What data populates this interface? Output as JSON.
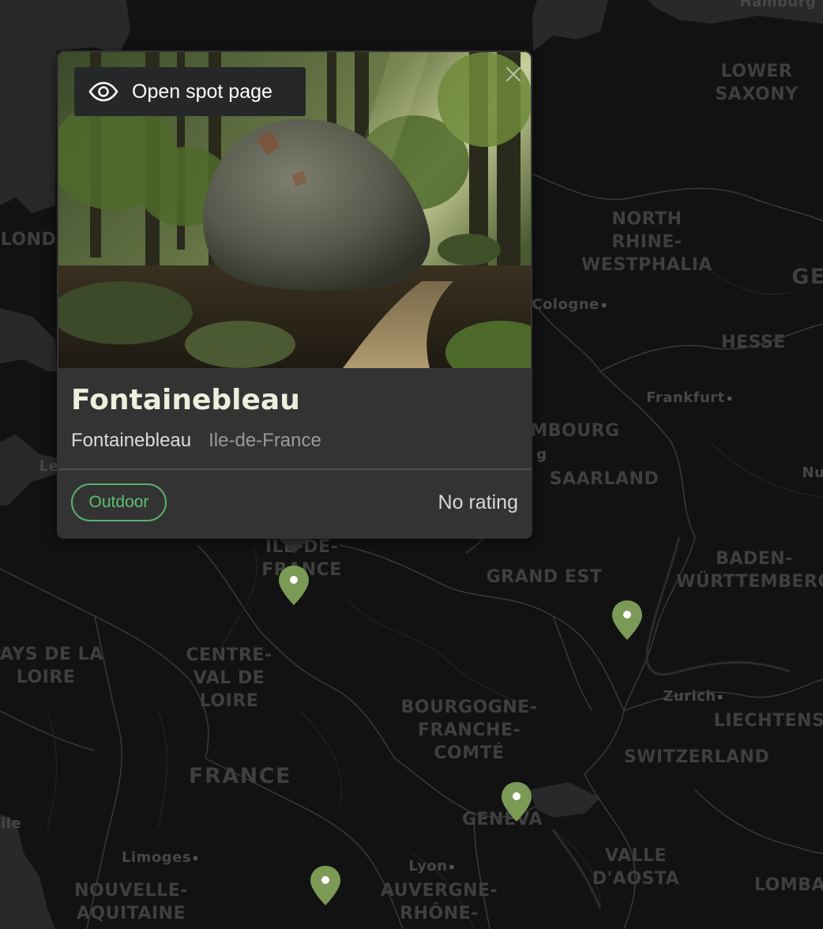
{
  "map": {
    "colors": {
      "background": "#121212",
      "land": "#1a1a1a",
      "water": "#2a2a2b",
      "borders": "#3a3a3a",
      "labels": "#3f3f3f",
      "marker": "#7a9a55"
    },
    "labels": [
      {
        "text": "Hamburg",
        "kind": "city"
      },
      {
        "text": "LOWER\nSAXONY",
        "kind": "region"
      },
      {
        "text": "LOND",
        "kind": "region"
      },
      {
        "text": "NORTH\nRHINE-\nWESTPHALIA",
        "kind": "region"
      },
      {
        "text": "GE",
        "kind": "country"
      },
      {
        "text": "Cologne",
        "kind": "city"
      },
      {
        "text": "HESSE",
        "kind": "region"
      },
      {
        "text": "Frankfurt",
        "kind": "city"
      },
      {
        "text": "MBOURG",
        "kind": "region"
      },
      {
        "text": "g",
        "kind": "city"
      },
      {
        "text": "SAARLAND",
        "kind": "region"
      },
      {
        "text": "Le",
        "kind": "city"
      },
      {
        "text": "Nu",
        "kind": "city"
      },
      {
        "text": "ILE-DE-\nFRANCE",
        "kind": "region"
      },
      {
        "text": "GRAND EST",
        "kind": "region"
      },
      {
        "text": "BADEN-\nWÜRTTEMBERG",
        "kind": "region"
      },
      {
        "text": "PAYS DE LA\nLOIRE",
        "kind": "region"
      },
      {
        "text": "CENTRE-\nVAL DE\nLOIRE",
        "kind": "region"
      },
      {
        "text": "BOURGOGNE-\nFRANCHE-\nCOMTÉ",
        "kind": "region"
      },
      {
        "text": "Zurich",
        "kind": "city"
      },
      {
        "text": "LIECHTENS",
        "kind": "region"
      },
      {
        "text": "SWITZERLAND",
        "kind": "region"
      },
      {
        "text": "FRANCE",
        "kind": "country"
      },
      {
        "text": "GENEVA",
        "kind": "region"
      },
      {
        "text": "VALLE\nD'AOSTA",
        "kind": "region"
      },
      {
        "text": "lle",
        "kind": "city"
      },
      {
        "text": "Limoges",
        "kind": "city"
      },
      {
        "text": "Lyon",
        "kind": "city"
      },
      {
        "text": "NOUVELLE-\nAQUITAINE",
        "kind": "region"
      },
      {
        "text": "AUVERGNE-\nRHÔNE-",
        "kind": "region"
      },
      {
        "text": "LOMBA",
        "kind": "region"
      }
    ],
    "markers": [
      {
        "name": "fontainebleau-marker"
      },
      {
        "name": "vosges-marker"
      },
      {
        "name": "geneva-marker"
      },
      {
        "name": "auvergne-marker"
      }
    ]
  },
  "popup": {
    "open_button_label": "Open spot page",
    "title": "Fontainebleau",
    "city": "Fontainebleau",
    "region": "Ile-de-France",
    "tag": "Outdoor",
    "rating": "No rating",
    "accent_color": "#5ab06a"
  }
}
